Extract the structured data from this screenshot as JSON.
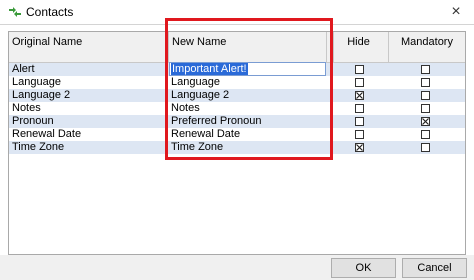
{
  "window": {
    "title": "Contacts",
    "close_glyph": "×"
  },
  "columns": {
    "original_name": "Original Name",
    "new_name": "New Name",
    "hide": "Hide",
    "mandatory": "Mandatory"
  },
  "rows": [
    {
      "original": "Alert",
      "new_name": "Important Alert!",
      "editing": true,
      "hide": false,
      "mandatory": false
    },
    {
      "original": "Language",
      "new_name": "Language",
      "editing": false,
      "hide": false,
      "mandatory": false
    },
    {
      "original": "Language 2",
      "new_name": "Language 2",
      "editing": false,
      "hide": true,
      "mandatory": false
    },
    {
      "original": "Notes",
      "new_name": "Notes",
      "editing": false,
      "hide": false,
      "mandatory": false
    },
    {
      "original": "Pronoun",
      "new_name": "Preferred Pronoun",
      "editing": false,
      "hide": false,
      "mandatory": true
    },
    {
      "original": "Renewal Date",
      "new_name": "Renewal Date",
      "editing": false,
      "hide": false,
      "mandatory": false
    },
    {
      "original": "Time Zone",
      "new_name": "Time Zone",
      "editing": false,
      "hide": true,
      "mandatory": false
    }
  ],
  "buttons": {
    "ok": "OK",
    "cancel": "Cancel"
  },
  "colors": {
    "row_alt": "#dde6f3",
    "selection": "#2a6ad8",
    "highlight": "#e0181e",
    "icon_green": "#3a9a3a"
  },
  "icons": {
    "app": "green-arrows-icon",
    "checkbox": "checkbox-icon"
  }
}
